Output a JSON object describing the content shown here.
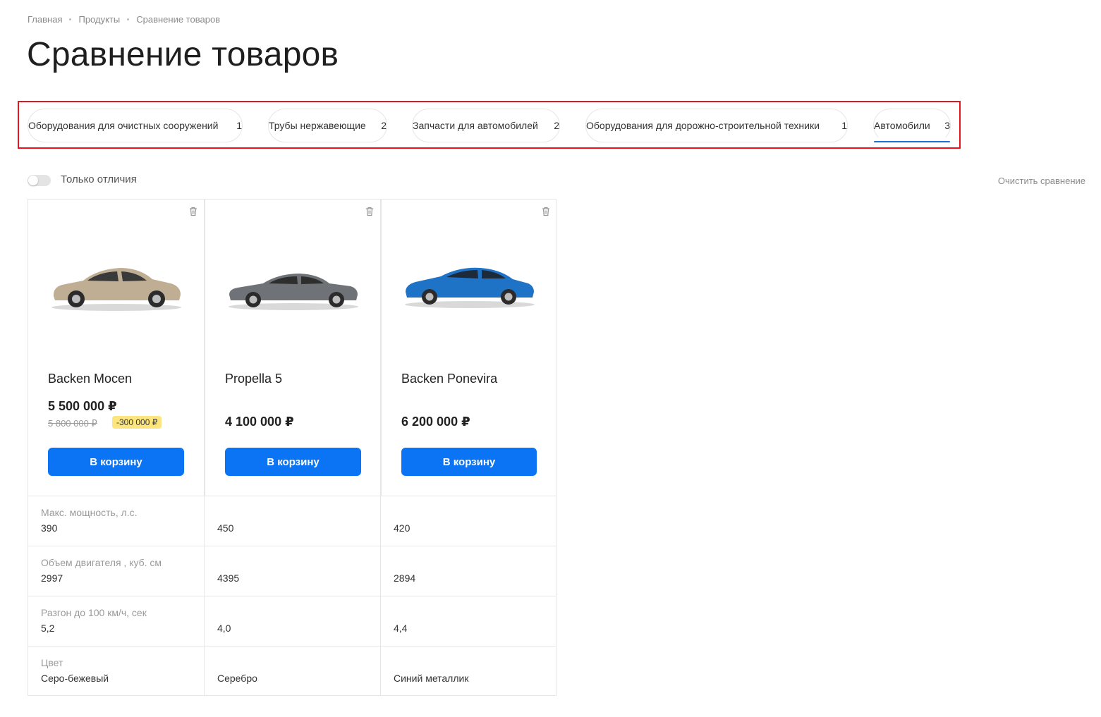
{
  "breadcrumb": [
    "Главная",
    "Продукты",
    "Сравнение товаров"
  ],
  "title": "Сравнение товаров",
  "tabs": [
    {
      "label": "Оборудования для очистных сооружений",
      "count": "1"
    },
    {
      "label": "Трубы нержавеющие",
      "count": "2"
    },
    {
      "label": "Запчасти для автомобилей",
      "count": "2"
    },
    {
      "label": "Оборудования для дорожно-строительной техники",
      "count": "1"
    },
    {
      "label": "Автомобили",
      "count": "3",
      "active": true
    }
  ],
  "toggle_label": "Только отличия",
  "clear_label": "Очистить сравнение",
  "products": [
    {
      "name": "Backen Mocen",
      "price": "5 500 000 ₽",
      "old_price": "5 800 000 ₽",
      "discount": "-300 000 ₽",
      "button": "В корзину",
      "car_color": "#bfae93"
    },
    {
      "name": "Propella 5",
      "price": "4 100 000 ₽",
      "button": "В корзину",
      "car_color": "#6f7276"
    },
    {
      "name": "Backen Ponevira",
      "price": "6 200 000 ₽",
      "button": "В корзину",
      "car_color": "#1f73c6"
    }
  ],
  "specs": [
    {
      "label": "Макс. мощность, л.с.",
      "values": [
        "390",
        "450",
        "420"
      ]
    },
    {
      "label": "Объем двигателя , куб. см",
      "values": [
        "2997",
        "4395",
        "2894"
      ]
    },
    {
      "label": "Разгон до 100 км/ч, сек",
      "values": [
        "5,2",
        "4,0",
        "4,4"
      ]
    },
    {
      "label": "Цвет",
      "values": [
        "Серо-бежевый",
        "Серебро",
        "Синий металлик"
      ]
    }
  ],
  "colors": {
    "accent": "#0b74f4",
    "active_tab_underline": "#1f6fd8",
    "highlight_frame": "#e8141c",
    "discount_bg": "#fbe57c"
  }
}
